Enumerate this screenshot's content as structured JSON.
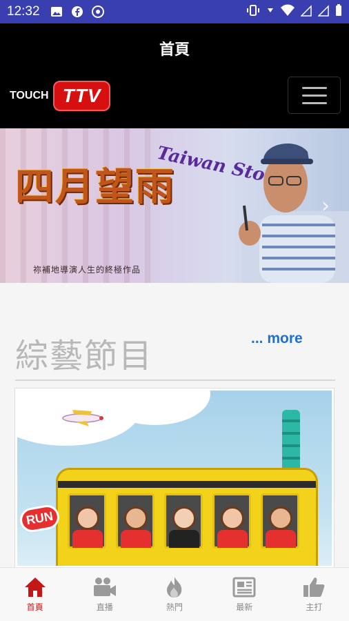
{
  "status_bar": {
    "time": "12:32",
    "left_icons": [
      "image-icon",
      "facebook-icon",
      "chrome-icon"
    ],
    "right_icons": [
      "vibrate-icon",
      "data-arrows-icon",
      "wifi-icon",
      "signal-icon",
      "signal-icon",
      "battery-icon"
    ]
  },
  "app_bar": {
    "title": "首頁"
  },
  "navbar": {
    "logo_touch": "TOUCH",
    "logo_ttv": "TTV",
    "menu_icon": "hamburger-icon"
  },
  "banner": {
    "title": "四月望雨",
    "script_text": "Taiwan Story",
    "tagline": "祢補地導演人生的終極作品",
    "next_icon": "chevron-right-icon"
  },
  "section": {
    "title": "綜藝節目",
    "more_label": "... more",
    "card_badge": "RUN"
  },
  "bottom_nav": {
    "tabs": [
      {
        "label": "首頁",
        "icon": "home-icon",
        "active": true
      },
      {
        "label": "直播",
        "icon": "video-camera-icon",
        "active": false
      },
      {
        "label": "熱門",
        "icon": "fire-icon",
        "active": false
      },
      {
        "label": "最新",
        "icon": "newspaper-icon",
        "active": false
      },
      {
        "label": "主打",
        "icon": "thumbs-up-icon",
        "active": false
      }
    ]
  },
  "colors": {
    "status_bar": "#3a3fb0",
    "header": "#000000",
    "accent_red": "#c41818",
    "link_blue": "#1f6fd1",
    "inactive_gray": "#8a8a8a"
  }
}
